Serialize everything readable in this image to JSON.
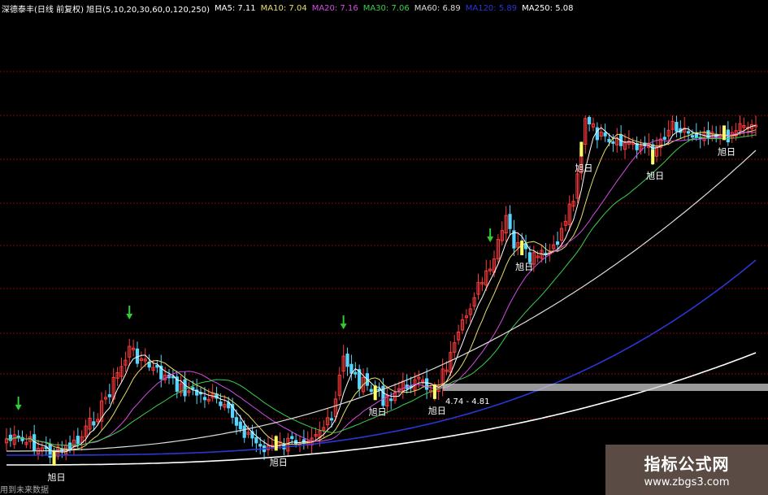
{
  "header": {
    "stock_label": "深德泰丰(日线 前复权) 旭日(5,10,20,30,60,0,120,250)",
    "ma5": "MA5: 7.11",
    "ma10": "MA10: 7.04",
    "ma20": "MA20: 7.16",
    "ma30": "MA30: 7.06",
    "ma60": "MA60: 6.89",
    "ma120": "MA120: 5.89",
    "ma250": "MA250: 5.08"
  },
  "colors": {
    "background": "#000000",
    "grid": "#8b0000",
    "up_candle": "#ff3b3b",
    "down_candle": "#56d6ff",
    "ma5": "#ffffff",
    "ma10": "#e5e06a",
    "ma20": "#d24de0",
    "ma30": "#3bcf4f",
    "ma60": "#dcdcdc",
    "ma120": "#2b36d6",
    "ma250": "#ffffff",
    "signal_arrow": "#33cc33",
    "signal_bar": "#ffff66",
    "band": "#cccccc"
  },
  "chart_data": {
    "type": "line",
    "signals": [
      {
        "label": "旭日",
        "index": 12
      },
      {
        "label": "旭日",
        "index": 68
      },
      {
        "label": "旭日",
        "index": 93
      },
      {
        "label": "旭日",
        "index": 108
      },
      {
        "label": "旭日",
        "index": 130
      },
      {
        "label": "旭日",
        "index": 145
      },
      {
        "label": "旭日",
        "index": 163
      },
      {
        "label": "旭日",
        "index": 181
      }
    ],
    "arrows": [
      3,
      31,
      85,
      122
    ],
    "price_band": "4.74 - 4.81",
    "series": [
      {
        "key": "ma120",
        "values": [
          3.2,
          3.3,
          3.4,
          3.5,
          3.6,
          3.7,
          3.8,
          4.0,
          4.3,
          4.8,
          5.3,
          5.9
        ]
      },
      {
        "key": "ma250",
        "values": [
          3.0,
          3.05,
          3.1,
          3.15,
          3.2,
          3.25,
          3.3,
          3.4,
          3.6,
          3.9,
          4.2,
          4.5
        ]
      }
    ]
  },
  "watermark": {
    "title": "指标公式网",
    "url": "www.zbgs3.com"
  },
  "footer": {
    "note": "用到未来数据"
  }
}
